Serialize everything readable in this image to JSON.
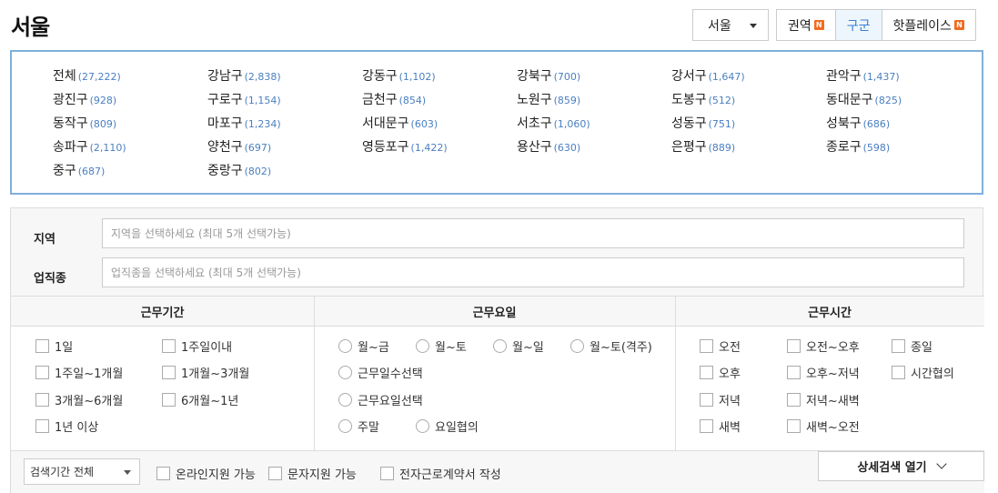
{
  "page_title": "서울",
  "city_select": {
    "value": "서울"
  },
  "tabs": [
    {
      "label": "권역",
      "badge": "N"
    },
    {
      "label": "구군",
      "badge": ""
    },
    {
      "label": "핫플레이스",
      "badge": "N"
    }
  ],
  "districts": [
    {
      "name": "전체",
      "count": "(27,222)"
    },
    {
      "name": "강남구",
      "count": "(2,838)"
    },
    {
      "name": "강동구",
      "count": "(1,102)"
    },
    {
      "name": "강북구",
      "count": "(700)"
    },
    {
      "name": "강서구",
      "count": "(1,647)"
    },
    {
      "name": "관악구",
      "count": "(1,437)"
    },
    {
      "name": "광진구",
      "count": "(928)"
    },
    {
      "name": "구로구",
      "count": "(1,154)"
    },
    {
      "name": "금천구",
      "count": "(854)"
    },
    {
      "name": "노원구",
      "count": "(859)"
    },
    {
      "name": "도봉구",
      "count": "(512)"
    },
    {
      "name": "동대문구",
      "count": "(825)"
    },
    {
      "name": "동작구",
      "count": "(809)"
    },
    {
      "name": "마포구",
      "count": "(1,234)"
    },
    {
      "name": "서대문구",
      "count": "(603)"
    },
    {
      "name": "서초구",
      "count": "(1,060)"
    },
    {
      "name": "성동구",
      "count": "(751)"
    },
    {
      "name": "성북구",
      "count": "(686)"
    },
    {
      "name": "송파구",
      "count": "(2,110)"
    },
    {
      "name": "양천구",
      "count": "(697)"
    },
    {
      "name": "영등포구",
      "count": "(1,422)"
    },
    {
      "name": "용산구",
      "count": "(630)"
    },
    {
      "name": "은평구",
      "count": "(889)"
    },
    {
      "name": "종로구",
      "count": "(598)"
    },
    {
      "name": "중구",
      "count": "(687)"
    },
    {
      "name": "중랑구",
      "count": "(802)"
    }
  ],
  "filters": {
    "region": {
      "label": "지역",
      "placeholder": "지역을 선택하세요 (최대 5개 선택가능)"
    },
    "job": {
      "label": "업직종",
      "placeholder": "업직종을 선택하세요 (최대 5개 선택가능)"
    }
  },
  "work_period": {
    "header": "근무기간",
    "options": [
      "1일",
      "1주일이내",
      "1주일~1개월",
      "1개월~3개월",
      "3개월~6개월",
      "6개월~1년",
      "1년 이상"
    ]
  },
  "work_days": {
    "header": "근무요일",
    "options": [
      "월~금",
      "월~토",
      "월~일",
      "월~토(격주)",
      "근무일수선택",
      "근무요일선택",
      "주말",
      "요일협의"
    ]
  },
  "work_hours": {
    "header": "근무시간",
    "options": [
      "오전",
      "오전~오후",
      "종일",
      "오후",
      "오후~저녁",
      "시간협의",
      "저녁",
      "저녁~새벽",
      "새벽",
      "새벽~오전"
    ]
  },
  "bottom": {
    "period_select": "검색기간 전체",
    "online": "온라인지원 가능",
    "sms": "문자지원 가능",
    "contract": "전자근로계약서 작성",
    "detail_button": "상세검색 열기"
  }
}
